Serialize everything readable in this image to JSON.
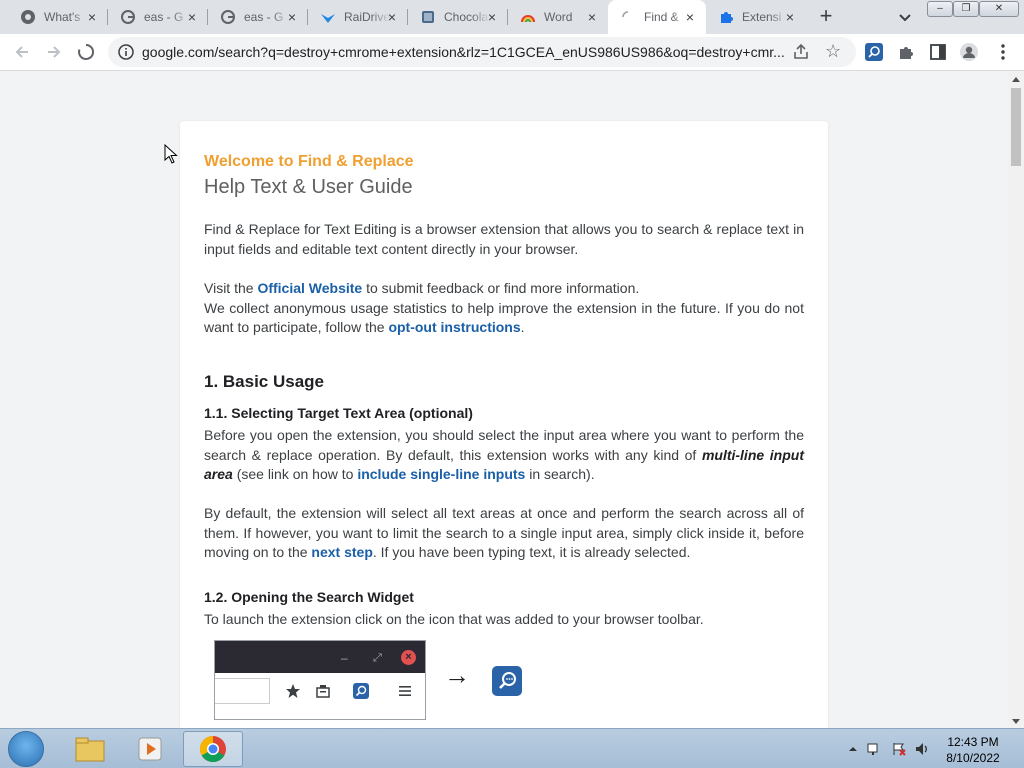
{
  "tabs": [
    {
      "title": "What's",
      "icon": "github-icon"
    },
    {
      "title": "eas - G",
      "icon": "google-icon"
    },
    {
      "title": "eas - G",
      "icon": "google-icon"
    },
    {
      "title": "RaiDrive",
      "icon": "raidrive-icon"
    },
    {
      "title": "Chocola",
      "icon": "chocolatey-icon"
    },
    {
      "title": "Word",
      "icon": "rainbow-icon"
    },
    {
      "title": "Find &",
      "icon": "loading-icon"
    },
    {
      "title": "Extensi",
      "icon": "puzzle-icon"
    }
  ],
  "active_tab_index": 6,
  "omnibox": {
    "url": "google.com/search?q=destroy+cmrome+extension&rlz=1C1GCEA_enUS986US986&oq=destroy+cmr..."
  },
  "page": {
    "welcome": "Welcome to Find & Replace",
    "title": "Help Text & User Guide",
    "intro": "Find & Replace for Text Editing is a browser extension that allows you to search & replace text in input fields and editable text content directly in your browser.",
    "visit_prefix": "Visit the ",
    "official_website_link": "Official Website",
    "visit_suffix": " to submit feedback or find more information.",
    "collect_text": "We collect anonymous usage statistics to help improve the extension in the future. If you do not want to participate, follow the ",
    "optout_link": "opt-out instructions",
    "collect_end": ".",
    "section1": "1. Basic Usage",
    "section1_1": "1.1. Selecting Target Text Area (optional)",
    "p1_a": "Before you open the extension, you should select the input area where you want to perform the search & replace operation. By default, this extension works with any kind of ",
    "p1_em": "multi-line input area",
    "p1_b": " (see link on how to ",
    "p1_link": "include single-line inputs",
    "p1_c": " in search).",
    "p2_a": "By default, the extension will select all text areas at once and perform the search across all of them. If however, you want to limit the search to a single input area, simply click inside it, before moving on to the ",
    "p2_link": "next step",
    "p2_b": ". If you have been typing text, it is already selected.",
    "section1_2": "1.2. Opening the Search Widget",
    "p3": "To launch the extension click on the icon that was added to your browser toolbar.",
    "demo_minimize": "–",
    "demo_restore": "⤢",
    "demo_close": "×",
    "arrow": "→"
  },
  "taskbar": {
    "time": "12:43 PM",
    "date": "8/10/2022"
  },
  "colors": {
    "welcome": "#f0a030",
    "link": "#1a5fa8",
    "extension": "#2a63a8"
  }
}
